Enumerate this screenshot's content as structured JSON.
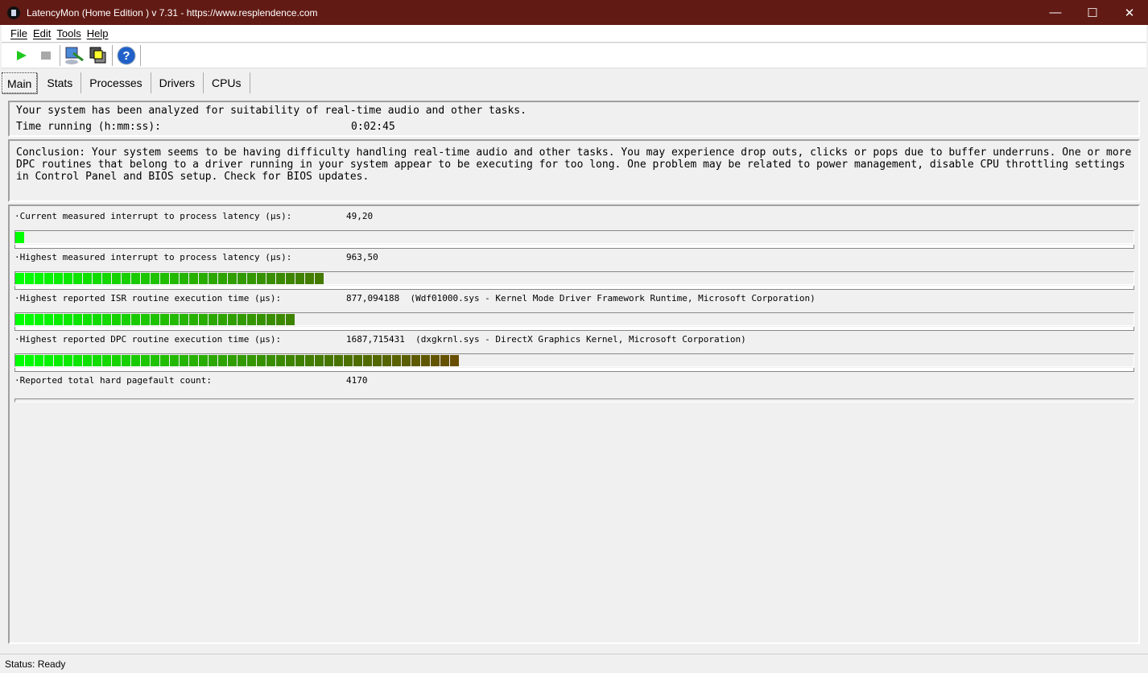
{
  "window": {
    "title": "LatencyMon  (Home Edition )  v 7.31 - https://www.resplendence.com",
    "minimize": "—",
    "maximize": "☐",
    "close": "✕"
  },
  "menu": [
    "File",
    "Edit",
    "Tools",
    "Help"
  ],
  "toolbar": {
    "icons": [
      "play-icon",
      "stop-icon",
      "monitor-icon",
      "windows-icon",
      "help-icon"
    ]
  },
  "tabs": [
    "Main",
    "Stats",
    "Processes",
    "Drivers",
    "CPUs"
  ],
  "summary": {
    "line1": "Your system has been analyzed for suitability of real-time audio and other tasks.",
    "time_label": "Time running (h:mm:ss):",
    "time_value": "0:02:45"
  },
  "conclusion": "Conclusion: Your system seems to be having difficulty handling real-time audio and other tasks. You may experience drop outs, clicks or pops due to buffer underruns. One or more DPC routines that belong to a driver running in your system appear to be executing for too long. One problem may be related to power management, disable CPU throttling settings in Control Panel and BIOS setup. Check for BIOS updates.",
  "metrics": [
    {
      "label": "·Current measured interrupt to process latency (µs):",
      "value": "49,20",
      "level": 0.009
    },
    {
      "label": "·Highest measured interrupt to process latency (µs):",
      "value": "963,50",
      "level": 0.276
    },
    {
      "label": "·Highest reported ISR routine execution time (µs):",
      "value": "877,094188  (Wdf01000.sys - Kernel Mode Driver Framework Runtime, Microsoft Corporation)",
      "level": 0.25
    },
    {
      "label": "·Highest reported DPC routine execution time (µs):",
      "value": "1687,715431  (dxgkrnl.sys - DirectX Graphics Kernel, Microsoft Corporation)",
      "level": 0.397
    },
    {
      "label": "·Reported total hard pagefault count:",
      "value": "4170",
      "level": 0
    }
  ],
  "colors": {
    "bar_start": "#00ff00",
    "bar_mid": "#3f8000",
    "bar_end": "#6b4a00"
  },
  "status": "Status: Ready"
}
